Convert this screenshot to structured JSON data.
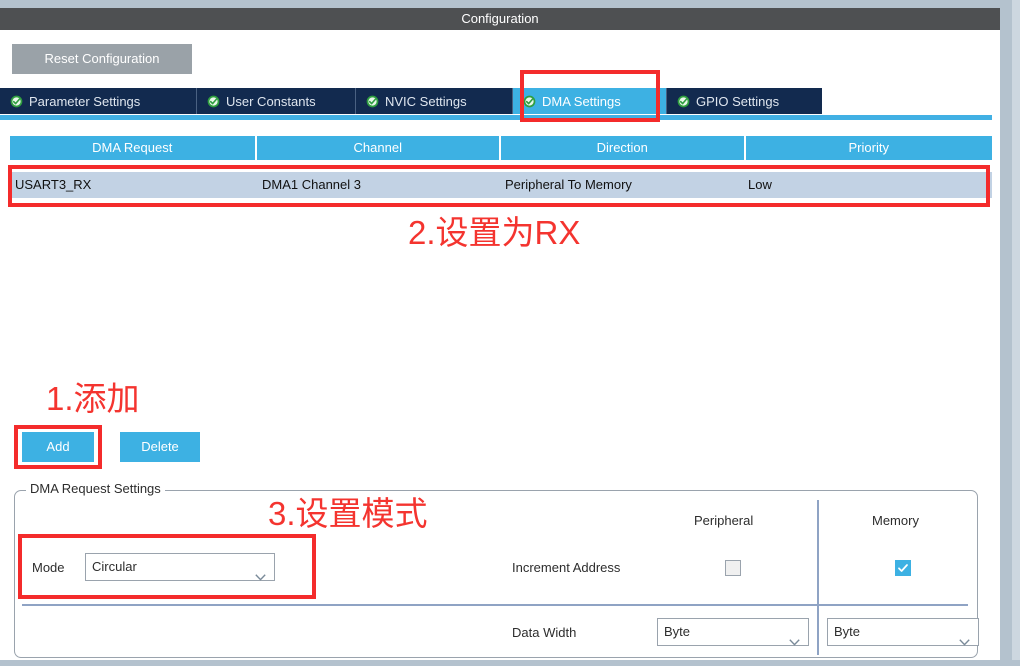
{
  "window": {
    "title": "Configuration"
  },
  "toolbar": {
    "reset_label": "Reset Configuration"
  },
  "tabs": [
    {
      "label": "Parameter Settings",
      "icon": "check-circle-icon",
      "active": false
    },
    {
      "label": "User Constants",
      "icon": "check-circle-icon",
      "active": false
    },
    {
      "label": "NVIC Settings",
      "icon": "check-circle-icon",
      "active": false
    },
    {
      "label": "DMA Settings",
      "icon": "check-circle-icon",
      "active": true
    },
    {
      "label": "GPIO Settings",
      "icon": "check-circle-icon",
      "active": false
    }
  ],
  "table": {
    "columns": [
      "DMA Request",
      "Channel",
      "Direction",
      "Priority"
    ],
    "rows": [
      {
        "dma_request": "USART3_RX",
        "channel": "DMA1 Channel 3",
        "direction": "Peripheral To Memory",
        "priority": "Low",
        "selected": true
      }
    ]
  },
  "actions": {
    "add_label": "Add",
    "delete_label": "Delete"
  },
  "settings": {
    "group_title": "DMA Request Settings",
    "mode_label": "Mode",
    "mode_value": "Circular",
    "peripheral_header": "Peripheral",
    "memory_header": "Memory",
    "increment_address_label": "Increment Address",
    "increment_peripheral_checked": false,
    "increment_memory_checked": true,
    "data_width_label": "Data Width",
    "data_width_peripheral": "Byte",
    "data_width_memory": "Byte"
  },
  "annotations": [
    {
      "text": "1.添加",
      "id": "an-1"
    },
    {
      "text": "2.设置为RX",
      "id": "an-2"
    },
    {
      "text": "3.设置模式",
      "id": "an-3"
    }
  ],
  "colors": {
    "accent_blue": "#3db1e3",
    "tab_navy": "#122a4f",
    "titlebar_gray": "#4e5052",
    "row_selected": "#c2d2e4",
    "annotation_red": "#f4342f"
  }
}
